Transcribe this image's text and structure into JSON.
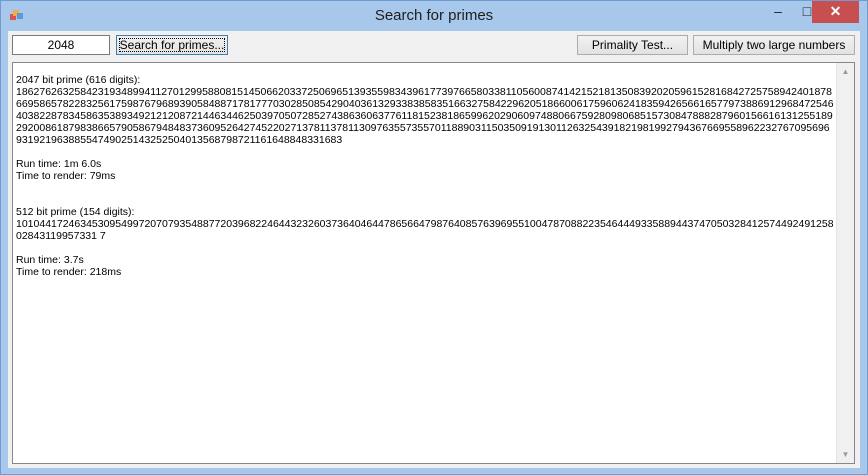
{
  "window": {
    "title": "Search for primes",
    "minimize_glyph": "–",
    "maximize_glyph": "□",
    "close_glyph": "✕",
    "app_icon": "windows-forms-app-icon"
  },
  "toolbar": {
    "bits_value": "2048",
    "search_label": "Search for primes...",
    "primality_label": "Primality Test...",
    "multiply_label": "Multiply two large numbers"
  },
  "output": {
    "result1_header": "2047 bit prime (616 digits):",
    "result1_digits": "1862762632584231934899411270129958808151450662033725069651393559834396177397665803381105600874142152181350839202059615281684272575894240187866958657822832561759876796893905848871781777030285085429040361329338385835166327584229620518660061759606241835942656616577973886912968472546403822878345863538934921212087214463446250397050728527438636063776118152381865996202906097488066759280980685157308478882879601566161312551892920086187983866579058679484837360952642745220271378113781130976355735570118890311503509191301126325439182198199279436766955896223276709569693192196388554749025143252504013568798721161648848331683",
    "result1_runtime": "Run time:  1m  6.0s",
    "result1_render": "Time to render:  79ms",
    "result2_header": "512 bit prime (154 digits):",
    "result2_digits": "1010441724634530954997207079354887720396822464432326037364046447865664798764085763969551004787088223546444933588944374705032841257449249125802843119957331 7",
    "result2_runtime": "Run time:  3.7s",
    "result2_render": "Time to render:  218ms"
  },
  "colors": {
    "titlebar": "#a7c8ea",
    "close_button": "#c74f4f",
    "client_bg": "#f0f0f0"
  }
}
